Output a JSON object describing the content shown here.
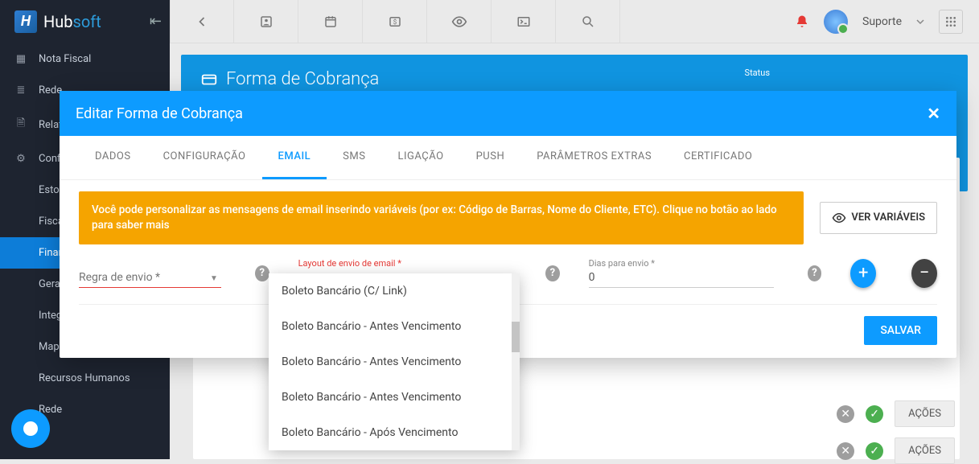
{
  "brand": {
    "name_a": "Hub",
    "name_b": "soft"
  },
  "topIcons": [
    "back",
    "person",
    "calendar",
    "dollar",
    "eye",
    "terminal",
    "search"
  ],
  "user": {
    "label": "Suporte"
  },
  "sidebar": {
    "items": [
      {
        "label": "Nota Fiscal",
        "icon": "file"
      },
      {
        "label": "Rede",
        "icon": "list"
      },
      {
        "label": "Relatórios",
        "icon": "doc"
      },
      {
        "label": "Config",
        "icon": "gear"
      },
      {
        "label": "Estoque",
        "icon": ""
      },
      {
        "label": "Fiscal",
        "icon": ""
      },
      {
        "label": "Financeiro",
        "icon": "",
        "active": true
      },
      {
        "label": "Geral",
        "icon": ""
      },
      {
        "label": "Integração",
        "icon": ""
      },
      {
        "label": "Mapeamento",
        "icon": ""
      },
      {
        "label": "Recursos Humanos",
        "icon": ""
      },
      {
        "label": "Rede",
        "icon": ""
      }
    ]
  },
  "page": {
    "title": "Forma de Cobrança",
    "statusLabel": "Status",
    "actionsBtn": "AÇÕES"
  },
  "modal": {
    "title": "Editar Forma de Cobrança",
    "tabs": [
      "DADOS",
      "CONFIGURAÇÃO",
      "EMAIL",
      "SMS",
      "LIGAÇÃO",
      "PUSH",
      "PARÂMETROS EXTRAS",
      "CERTIFICADO"
    ],
    "activeTab": 2,
    "banner": "Você pode personalizar as mensagens de email inserindo variáveis (por ex: Código de Barras, Nome do Cliente, ETC). Clique no botão ao lado para saber mais",
    "varsBtn": "VER VARIÁVEIS",
    "fields": {
      "regra": {
        "label": "Regra de envio *",
        "value": ""
      },
      "layout": {
        "label": "Layout de envio de email *",
        "value": ""
      },
      "dias": {
        "label": "Dias para envio *",
        "value": "0"
      }
    },
    "save": "SALVAR"
  },
  "dropdown": {
    "options": [
      "Boleto Bancário (C/ Link)",
      "Boleto Bancário - Antes Vencimento",
      "Boleto Bancário - Antes Vencimento",
      "Boleto Bancário - Antes Vencimento",
      "Boleto Bancário - Após Vencimento"
    ]
  }
}
